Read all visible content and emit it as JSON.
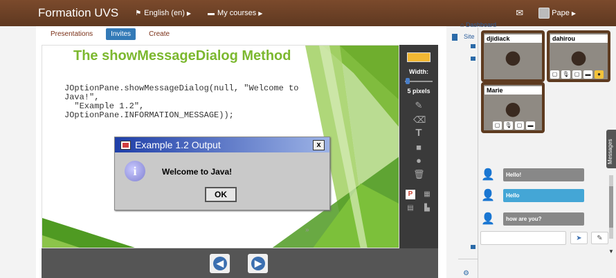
{
  "navbar": {
    "brand": "Formation UVS",
    "language": "English (en)",
    "my_courses": "My courses",
    "user": "Pape"
  },
  "tabs": [
    {
      "label": "Presentations",
      "active": false
    },
    {
      "label": "Invites",
      "active": true
    },
    {
      "label": "Create",
      "active": false
    }
  ],
  "slide": {
    "title": "The showMessageDialog Method",
    "code": "JOptionPane.showMessageDialog(null, \"Welcome to\nJava!\",\n  \"Example 1.2\",\nJOptionPane.INFORMATION_MESSAGE));",
    "page_marker": "»"
  },
  "dialog": {
    "title": "Example 1.2 Output",
    "message": "Welcome to Java!",
    "ok_label": "OK",
    "close_label": "x",
    "info_glyph": "i"
  },
  "tools": {
    "color": "#f2b833",
    "width_label": "Width:",
    "width_value": "5 pixels",
    "items": [
      "pencil-icon",
      "eraser-icon",
      "text-icon",
      "rectangle-icon",
      "circle-icon",
      "trash-icon"
    ]
  },
  "slide_nav": {
    "prev_glyph": "◀",
    "next_glyph": "▶"
  },
  "sidebar": {
    "dashboard": "Dashboard",
    "site": "Site"
  },
  "videos": [
    {
      "name": "djidiack"
    },
    {
      "name": "dahirou"
    },
    {
      "name": "Marie"
    }
  ],
  "chat": {
    "messages": [
      {
        "text": "Hello!",
        "highlight": false
      },
      {
        "text": "Hello",
        "highlight": true
      },
      {
        "text": "how are you?",
        "highlight": false
      }
    ],
    "input_placeholder": "",
    "messages_tab": "Messages"
  }
}
